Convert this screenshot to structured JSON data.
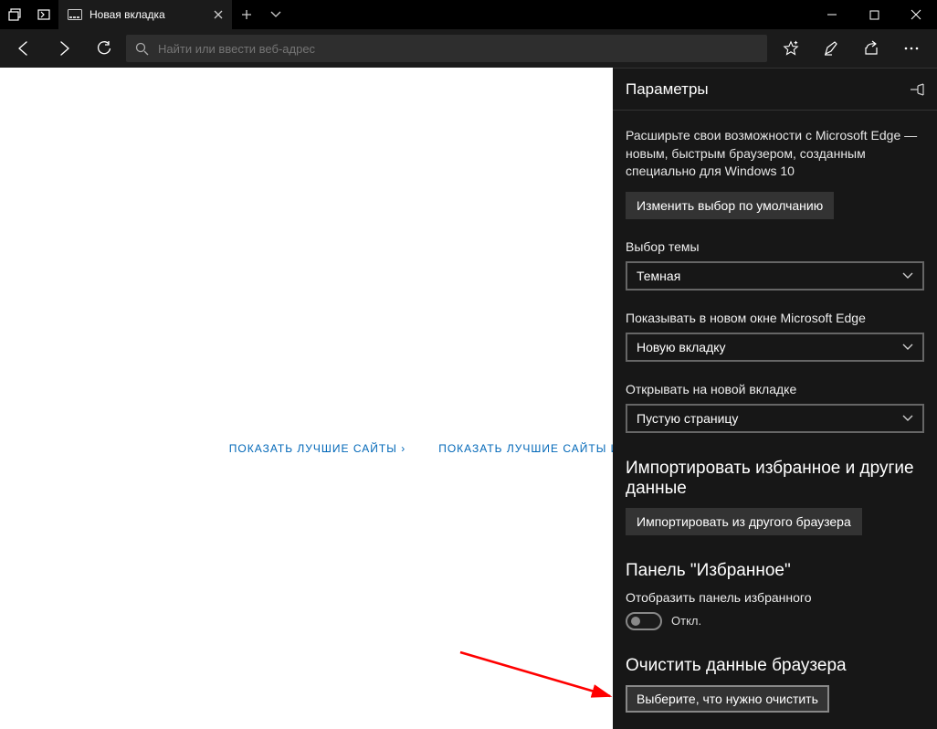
{
  "titlebar": {
    "tab_title": "Новая вкладка"
  },
  "toolbar": {
    "search_placeholder": "Найти или ввести веб-адрес"
  },
  "newtab": {
    "link_top_sites": "ПОКАЗАТЬ ЛУЧШИЕ САЙТЫ ›",
    "link_top_sites_feed": "ПОКАЗАТЬ ЛУЧШИЕ САЙТЫ И МОЮ ЛЕНТУ ›"
  },
  "panel": {
    "title": "Параметры",
    "promo_text": "Расширьте свои возможности с Microsoft Edge — новым, быстрым браузером, созданным специально для Windows 10",
    "change_default_btn": "Изменить выбор по умолчанию",
    "theme_label": "Выбор темы",
    "theme_value": "Темная",
    "show_in_new_window_label": "Показывать в новом окне Microsoft Edge",
    "show_in_new_window_value": "Новую вкладку",
    "open_new_tab_label": "Открывать на новой вкладке",
    "open_new_tab_value": "Пустую страницу",
    "import_heading": "Импортировать избранное и другие данные",
    "import_btn": "Импортировать из другого браузера",
    "favorites_heading": "Панель \"Избранное\"",
    "show_favorites_label": "Отобразить панель избранного",
    "toggle_off_label": "Откл.",
    "clear_heading": "Очистить данные браузера",
    "clear_btn": "Выберите, что нужно очистить"
  }
}
